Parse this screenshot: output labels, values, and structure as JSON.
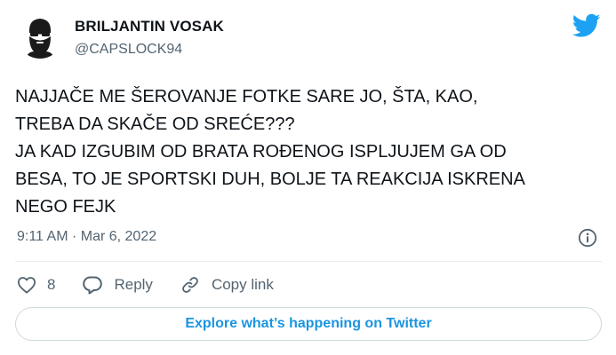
{
  "user": {
    "display_name": "BRILJANTIN VOSAK",
    "handle": "@CAPSLOCK94"
  },
  "tweet": {
    "text": "NAJJAČE ME ŠEROVANJE FOTKE SARE JO, ŠTA, KAO,\nTREBA DA SKAČE OD SREĆE???\nJA KAD IZGUBIM OD BRATA ROĐENOG ISPLJUJEM GA OD\nBESA, TO JE SPORTSKI DUH, BOLJE TA REAKCIJA ISKRENA\nNEGO FEJK",
    "timestamp": "9:11 AM · Mar 6, 2022"
  },
  "actions": {
    "like_count": "8",
    "reply_label": "Reply",
    "copy_link_label": "Copy link"
  },
  "explore_label": "Explore what’s happening on Twitter",
  "icons": {
    "avatar": "bearded-man-avatar",
    "brand": "twitter-bird-icon",
    "info": "info-icon",
    "like": "heart-icon",
    "reply": "reply-bubble-icon",
    "copy_link": "link-icon"
  },
  "colors": {
    "twitter_blue": "#1da1f2",
    "link_blue": "#1b95e0",
    "secondary_text": "#536471"
  }
}
